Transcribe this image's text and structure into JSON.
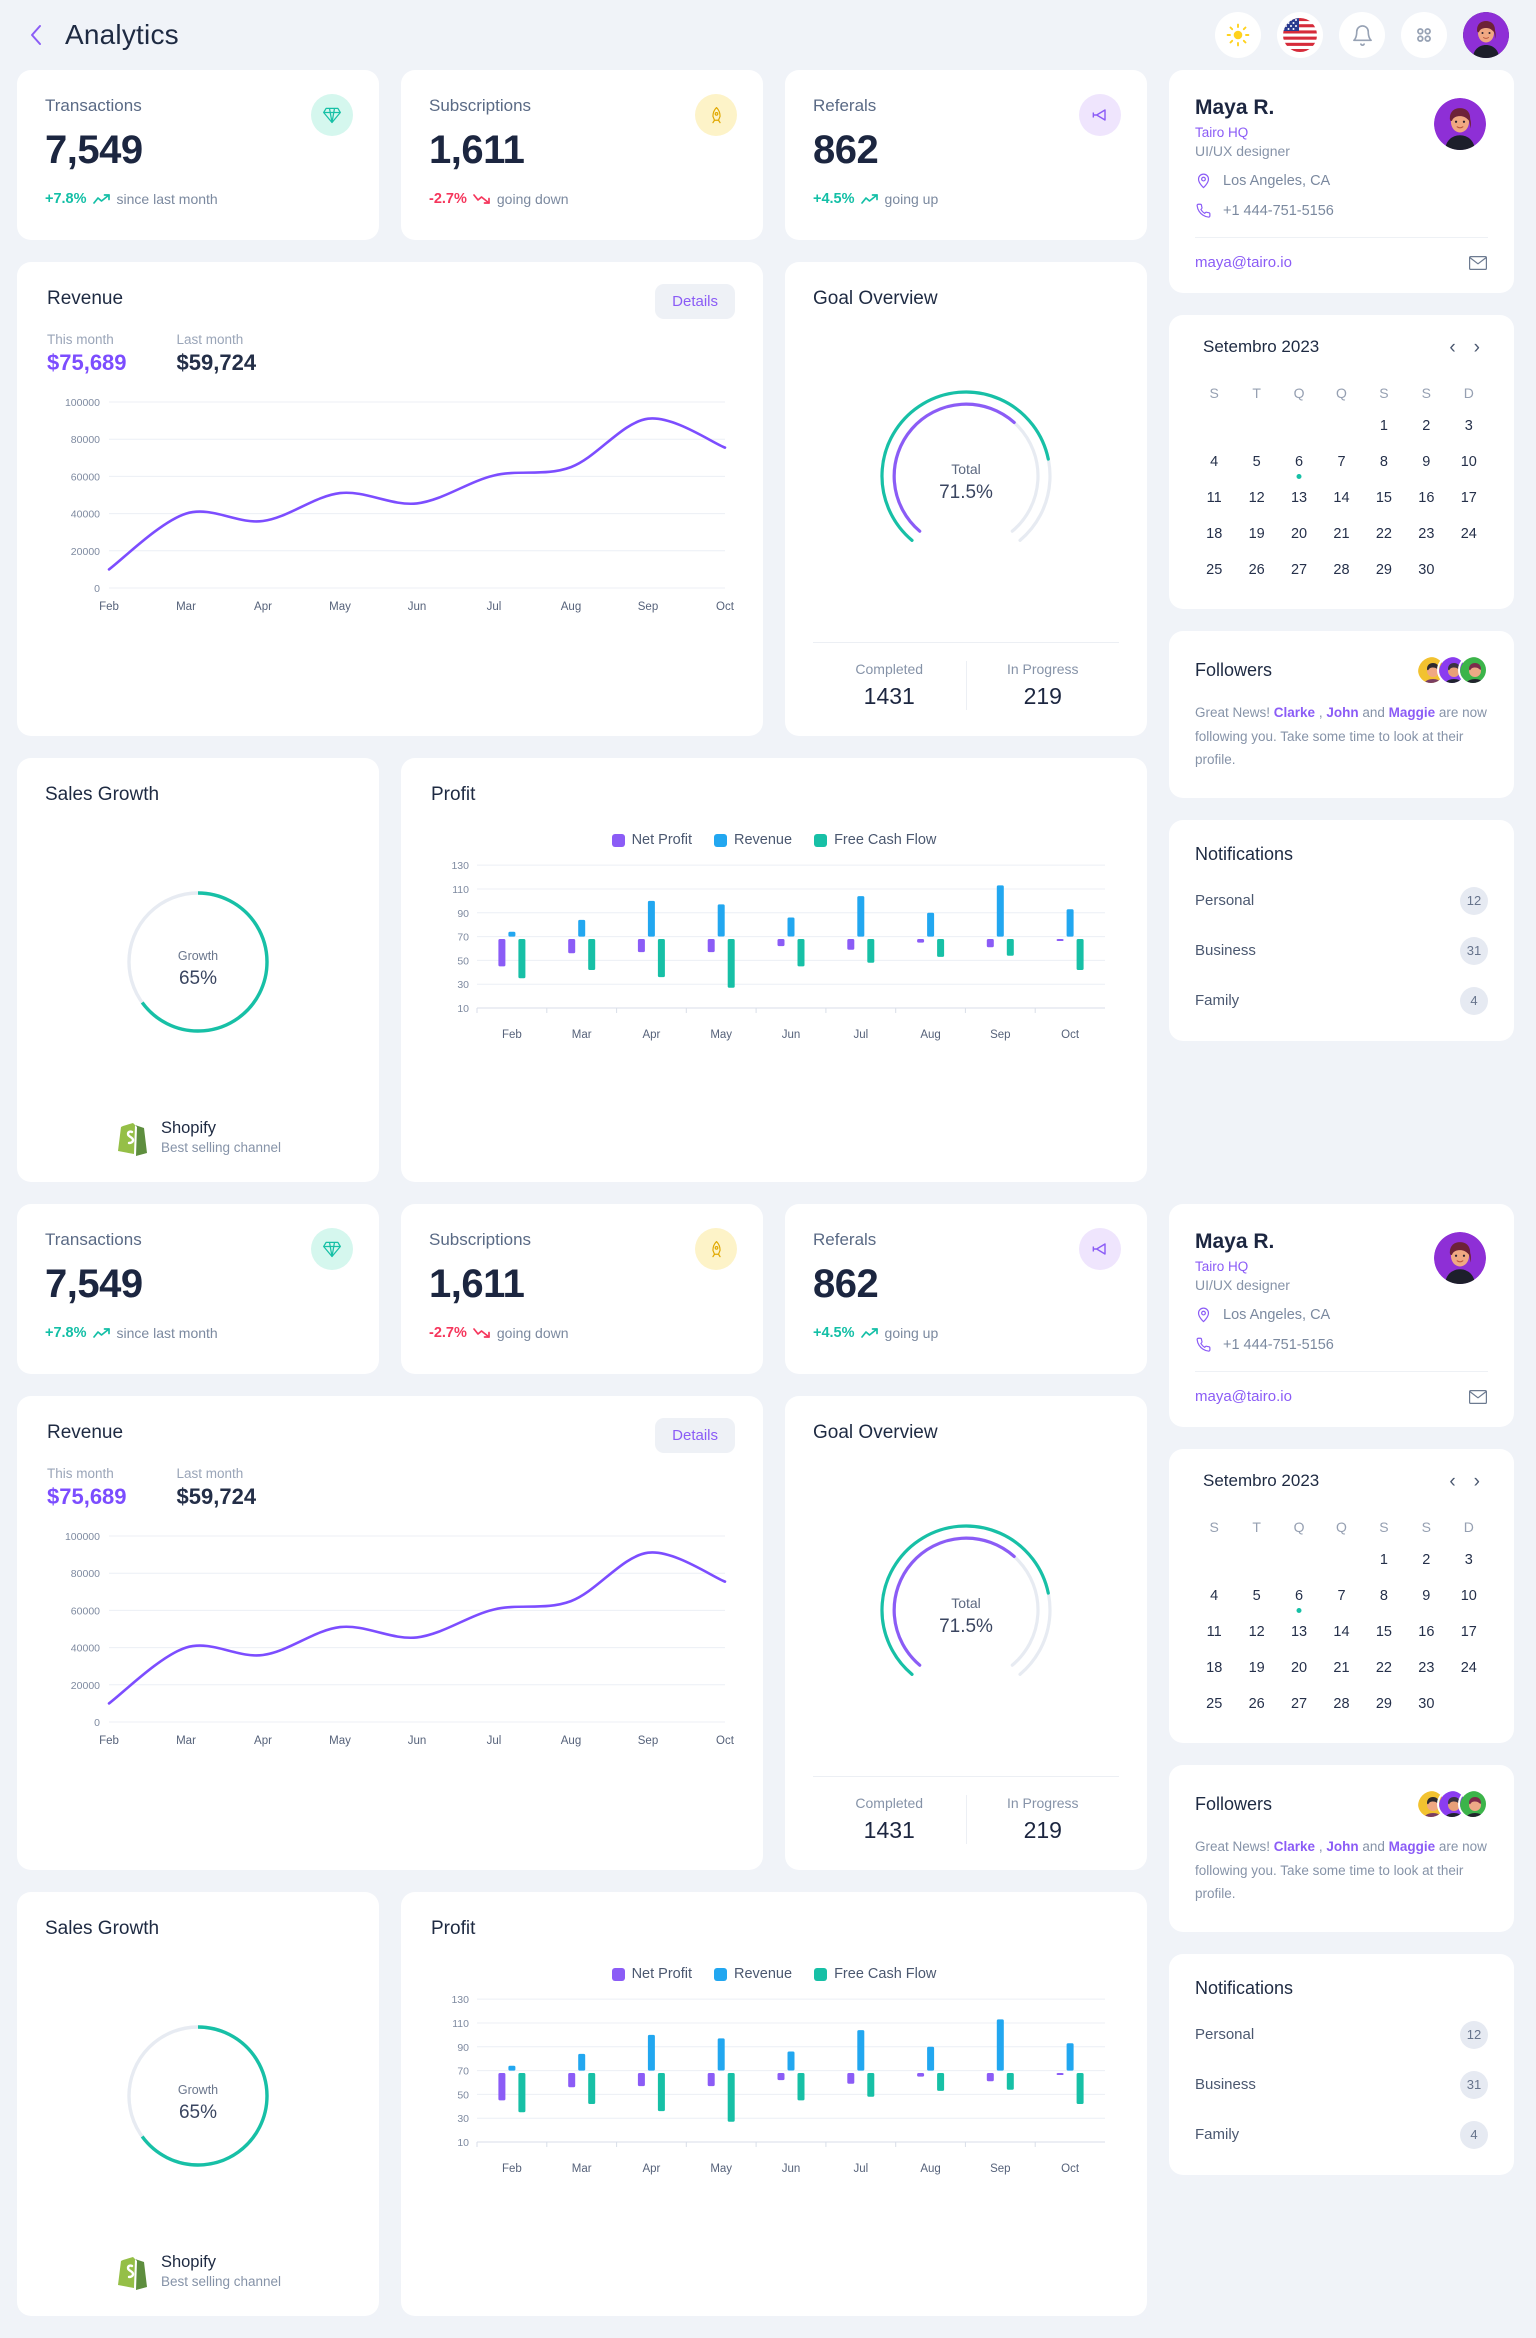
{
  "header": {
    "title": "Analytics",
    "back_icon": "chevron-left-icon",
    "icons": [
      {
        "name": "sun-icon",
        "label": "Light mode"
      },
      {
        "name": "flag-us-icon",
        "label": "Language"
      },
      {
        "name": "bell-icon",
        "label": "Notifications"
      },
      {
        "name": "apps-grid-icon",
        "label": "Apps"
      },
      {
        "name": "user-avatar",
        "label": "Profile"
      }
    ]
  },
  "stats": [
    {
      "label": "Transactions",
      "value": "7,549",
      "delta": "+7.8%",
      "delta_dir": "up",
      "note": "since last month",
      "icon": "diamond-icon",
      "icon_bg": "#d5f7ee",
      "icon_color": "#17c0a6"
    },
    {
      "label": "Subscriptions",
      "value": "1,611",
      "delta": "-2.7%",
      "delta_dir": "down",
      "note": "going down",
      "icon": "rocket-icon",
      "icon_bg": "#fdf3c8",
      "icon_color": "#e0a800"
    },
    {
      "label": "Referals",
      "value": "862",
      "delta": "+4.5%",
      "delta_dir": "up",
      "note": "going up",
      "icon": "megaphone-icon",
      "icon_bg": "#efe5fd",
      "icon_color": "#8b5cf6"
    }
  ],
  "revenue": {
    "title": "Revenue",
    "details_label": "Details",
    "this_month_label": "This month",
    "this_month_value": "$75,689",
    "last_month_label": "Last month",
    "last_month_value": "$59,724"
  },
  "goal": {
    "title": "Goal Overview",
    "center_label": "Total",
    "center_value": "71.5%",
    "completed_label": "Completed",
    "completed_value": "1431",
    "inprogress_label": "In Progress",
    "inprogress_value": "219"
  },
  "sales": {
    "title": "Sales Growth",
    "center_label": "Growth",
    "center_value": "65%",
    "channel_name": "Shopify",
    "channel_sub": "Best selling channel",
    "channel_icon": "shopify-bag-icon"
  },
  "profit": {
    "title": "Profit"
  },
  "profile": {
    "name": "Maya R.",
    "org": "Tairo HQ",
    "role": "UI/UX designer",
    "location": "Los Angeles, CA",
    "location_icon": "map-pin-icon",
    "phone": "+1 444-751-5156",
    "phone_icon": "phone-icon",
    "email": "maya@tairo.io",
    "email_icon": "envelope-icon"
  },
  "calendar": {
    "title": "Setembro 2023",
    "prev_icon": "chevron-left-icon",
    "next_icon": "chevron-right-icon",
    "weekdays": [
      "S",
      "T",
      "Q",
      "Q",
      "S",
      "S",
      "D"
    ],
    "weeks": [
      [
        "",
        "",
        "",
        "",
        "1",
        "2",
        "3"
      ],
      [
        "4",
        "5",
        "6",
        "7",
        "8",
        "9",
        "10"
      ],
      [
        "11",
        "12",
        "13",
        "14",
        "15",
        "16",
        "17"
      ],
      [
        "18",
        "19",
        "20",
        "21",
        "22",
        "23",
        "24"
      ],
      [
        "25",
        "26",
        "27",
        "28",
        "29",
        "30",
        ""
      ]
    ],
    "marked_day": "6"
  },
  "followers": {
    "title": "Followers",
    "text_pre": "Great News! ",
    "name1": "Clarke",
    "sep1": " , ",
    "name2": "John",
    "sep2": " and ",
    "name3": "Maggie",
    "text_post": " are now following you. Take some time to look at their profile.",
    "avatar_colors": [
      "#f2c230",
      "#8b3cf0",
      "#3cb44a"
    ]
  },
  "notifications": {
    "title": "Notifications",
    "rows": [
      {
        "label": "Personal",
        "count": "12"
      },
      {
        "label": "Business",
        "count": "31"
      },
      {
        "label": "Family",
        "count": "4"
      }
    ]
  },
  "colors": {
    "accent_purple": "#7c4dff",
    "legend_purple": "#8b5cf6",
    "legend_blue": "#22a7f0",
    "legend_teal": "#17c0a6",
    "up_green": "#13bfa6",
    "down_red": "#f5365c",
    "page_bg": "#f0f3f8",
    "card_bg": "#ffffff"
  },
  "chart_data": [
    {
      "type": "line",
      "title": "Revenue",
      "x": [
        "Feb",
        "Mar",
        "Apr",
        "May",
        "Jun",
        "Jul",
        "Aug",
        "Sep",
        "Oct"
      ],
      "series": [
        {
          "name": "Revenue",
          "color": "#7c4dff",
          "values": [
            10000,
            40000,
            36000,
            51000,
            45500,
            60500,
            65000,
            91000,
            75500
          ]
        }
      ],
      "ylabel": "",
      "xlabel": "",
      "yticks": [
        0,
        20000,
        40000,
        60000,
        80000,
        100000
      ],
      "ylim": [
        0,
        100000
      ],
      "grid": true,
      "legend": "none",
      "smooth": true
    },
    {
      "type": "bar",
      "title": "Profit",
      "subtype": "floating-range-bars",
      "categories": [
        "Feb",
        "Mar",
        "Apr",
        "May",
        "Jun",
        "Jul",
        "Aug",
        "Sep",
        "Oct"
      ],
      "yticks": [
        10,
        30,
        50,
        70,
        90,
        110,
        130
      ],
      "ylim": [
        10,
        136
      ],
      "grid": true,
      "legend": "top-center",
      "series": [
        {
          "name": "Net Profit",
          "color": "#8b5cf6",
          "ranges": [
            [
              45,
              68
            ],
            [
              56,
              68
            ],
            [
              57,
              68
            ],
            [
              57,
              68
            ],
            [
              62,
              68
            ],
            [
              59,
              68
            ],
            [
              65,
              68
            ],
            [
              61,
              68
            ],
            [
              67,
              68
            ]
          ]
        },
        {
          "name": "Revenue",
          "color": "#22a7f0",
          "ranges": [
            [
              70,
              74
            ],
            [
              70,
              84
            ],
            [
              70,
              100
            ],
            [
              70,
              97
            ],
            [
              70,
              86
            ],
            [
              70,
              104
            ],
            [
              70,
              90
            ],
            [
              70,
              113
            ],
            [
              70,
              93
            ]
          ]
        },
        {
          "name": "Free Cash Flow",
          "color": "#17c0a6",
          "ranges": [
            [
              35,
              68
            ],
            [
              42,
              68
            ],
            [
              36,
              68
            ],
            [
              27,
              68
            ],
            [
              45,
              68
            ],
            [
              48,
              68
            ],
            [
              53,
              68
            ],
            [
              54,
              68
            ],
            [
              42,
              68
            ]
          ]
        }
      ]
    },
    {
      "type": "pie",
      "subtype": "dual-gauge",
      "title": "Goal Overview",
      "center_label": "Total",
      "center_value": 71.5,
      "arcs": [
        {
          "name": "outer",
          "color": "#17c0a6",
          "percent": 78,
          "track": "#e7ebf2"
        },
        {
          "name": "inner",
          "color": "#8b5cf6",
          "percent": 65,
          "track": "#e7ebf2"
        }
      ]
    },
    {
      "type": "pie",
      "subtype": "donut",
      "title": "Sales Growth",
      "center_label": "Growth",
      "center_value": 65,
      "arcs": [
        {
          "name": "Growth",
          "color": "#17c0a6",
          "percent": 65,
          "track": "#e7ebf2"
        }
      ]
    }
  ]
}
